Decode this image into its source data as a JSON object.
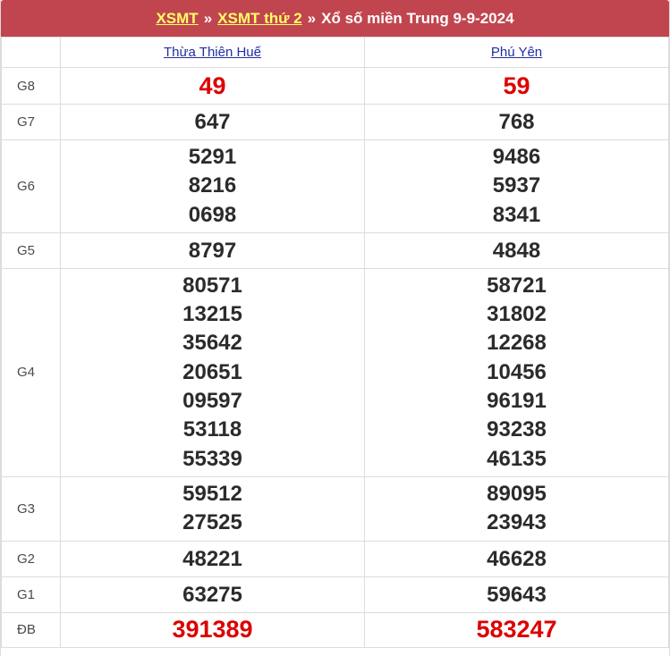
{
  "header": {
    "link1": "XSMT",
    "sep1": "»",
    "link2": "XSMT thứ 2",
    "sep2": "»",
    "title_rest": "Xổ số miền Trung 9-9-2024"
  },
  "provinces": [
    "Thừa Thiên Huế",
    "Phú Yên"
  ],
  "rows": {
    "g8": {
      "label": "G8",
      "p1": [
        "49"
      ],
      "p2": [
        "59"
      ]
    },
    "g7": {
      "label": "G7",
      "p1": [
        "647"
      ],
      "p2": [
        "768"
      ]
    },
    "g6": {
      "label": "G6",
      "p1": [
        "5291",
        "8216",
        "0698"
      ],
      "p2": [
        "9486",
        "5937",
        "8341"
      ]
    },
    "g5": {
      "label": "G5",
      "p1": [
        "8797"
      ],
      "p2": [
        "4848"
      ]
    },
    "g4": {
      "label": "G4",
      "p1": [
        "80571",
        "13215",
        "35642",
        "20651",
        "09597",
        "53118",
        "55339"
      ],
      "p2": [
        "58721",
        "31802",
        "12268",
        "10456",
        "96191",
        "93238",
        "46135"
      ]
    },
    "g3": {
      "label": "G3",
      "p1": [
        "59512",
        "27525"
      ],
      "p2": [
        "89095",
        "23943"
      ]
    },
    "g2": {
      "label": "G2",
      "p1": [
        "48221"
      ],
      "p2": [
        "46628"
      ]
    },
    "g1": {
      "label": "G1",
      "p1": [
        "63275"
      ],
      "p2": [
        "59643"
      ]
    },
    "db": {
      "label": "ĐB",
      "p1": [
        "391389"
      ],
      "p2": [
        "583247"
      ]
    }
  },
  "colors": {
    "header_bg": "#c1454f",
    "header_link": "#ffff66",
    "province_link": "#1f2fa3",
    "special_red": "#dd0000"
  }
}
